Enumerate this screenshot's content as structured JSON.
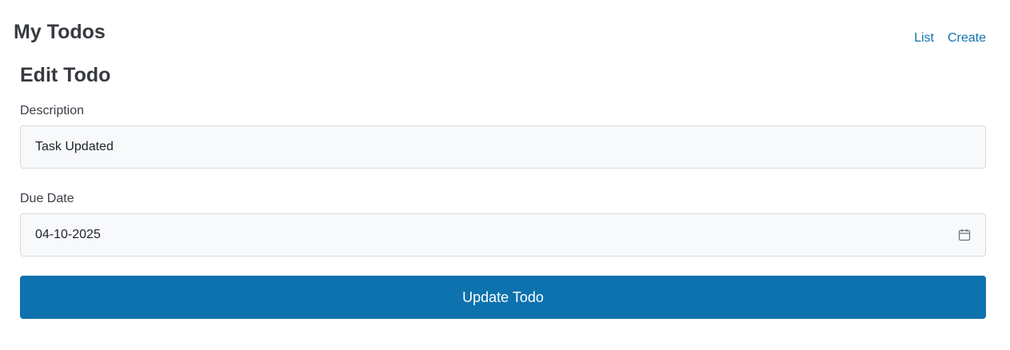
{
  "header": {
    "app_title": "My Todos",
    "nav": [
      {
        "label": "List"
      },
      {
        "label": "Create"
      }
    ]
  },
  "form": {
    "title": "Edit Todo",
    "description": {
      "label": "Description",
      "value": "Task Updated"
    },
    "due_date": {
      "label": "Due Date",
      "value": "04-10-2025",
      "icon": "calendar-icon"
    },
    "submit_label": "Update Todo"
  },
  "colors": {
    "link": "#0d74ad",
    "primary_button": "#0d72ae",
    "input_background": "#f8f9fa",
    "input_border": "#d7dade"
  }
}
